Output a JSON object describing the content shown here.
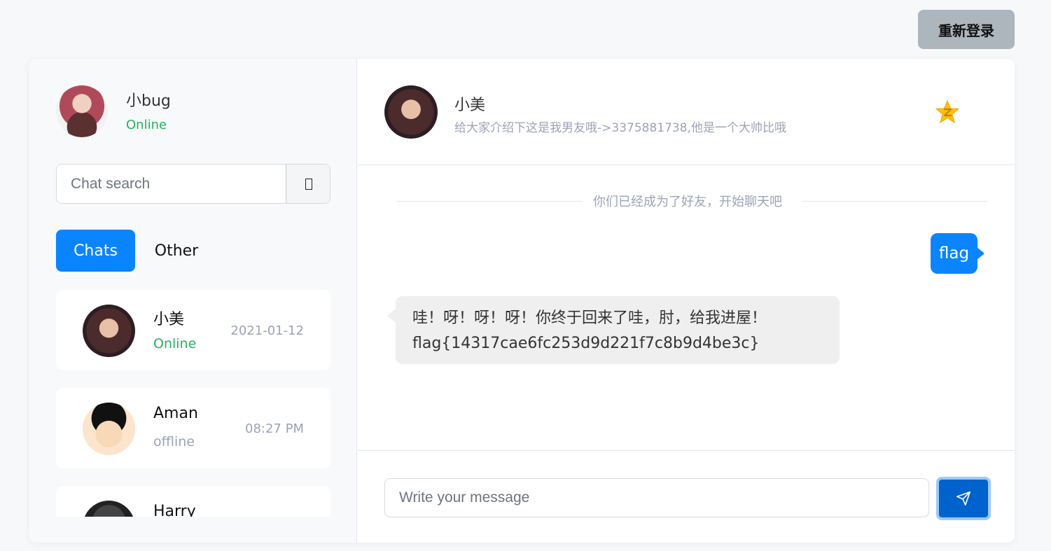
{
  "header": {
    "relogin_label": "重新登录"
  },
  "sidebar": {
    "me": {
      "name": "小bug",
      "status": "Online"
    },
    "search": {
      "placeholder": "Chat search"
    },
    "tabs": [
      {
        "label": "Chats",
        "active": true
      },
      {
        "label": "Other",
        "active": false
      }
    ],
    "contacts": [
      {
        "name": "小美",
        "status": "Online",
        "time": "2021-01-12"
      },
      {
        "name": "Aman",
        "status": "offline",
        "time": "08:27 PM"
      },
      {
        "name": "Harry",
        "status": "",
        "time": ""
      }
    ]
  },
  "chat": {
    "peer": {
      "name": "小美",
      "signature": "给大家介绍下这是我男友哦->3375881738,他是一个大帅比哦"
    },
    "system_notice": "你们已经成为了好友，开始聊天吧",
    "messages": [
      {
        "direction": "out",
        "text": "flag"
      },
      {
        "direction": "in",
        "line1": "哇！呀！呀！呀！你终于回来了哇，肘，给我进屋！",
        "line2": "flag{14317cae6fc253d9d221f7c8b9d4be3c}"
      }
    ],
    "composer": {
      "placeholder": "Write your message"
    }
  },
  "colors": {
    "accent": "#0a84ff",
    "online": "#22b35e",
    "muted": "#9aa3b5",
    "star": "#ffc107"
  },
  "icons": {
    "search_button": "search-icon",
    "favorite": "qq-star-icon",
    "send": "send-icon"
  }
}
